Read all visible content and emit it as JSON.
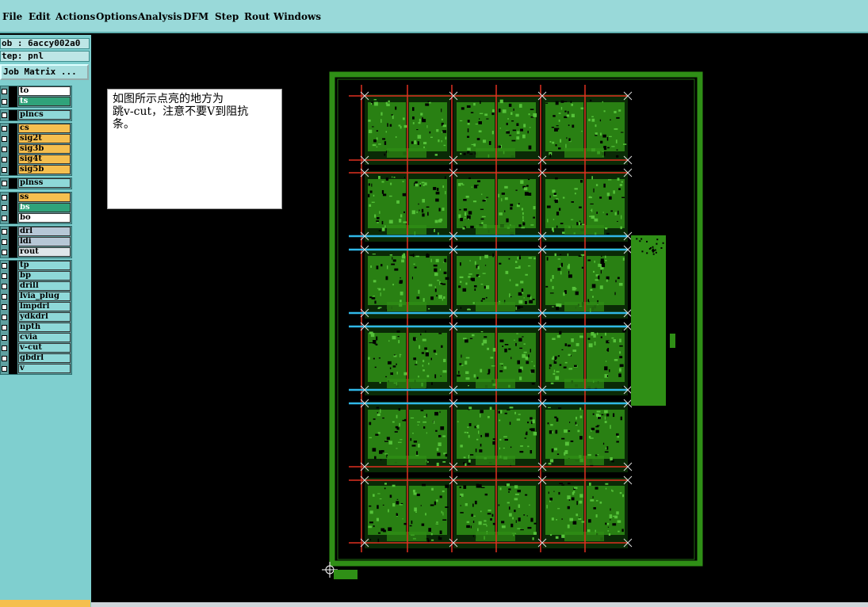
{
  "menu": {
    "items": [
      "File",
      "Edit",
      "Actions",
      "Options",
      "Analysis",
      "DFM",
      "Step",
      "Rout",
      "Windows"
    ]
  },
  "job_info": {
    "job": "ob : 6accy002a0",
    "step": "tep: pnl",
    "job_matrix_button": "Job Matrix ..."
  },
  "layers": [
    {
      "name": "to",
      "color": "w"
    },
    {
      "name": "ts",
      "color": "g"
    },
    {
      "name": "plncs",
      "color": "c"
    },
    {
      "name": "cs",
      "color": "o"
    },
    {
      "name": "sig2t",
      "color": "o"
    },
    {
      "name": "sig3b",
      "color": "o"
    },
    {
      "name": "sig4t",
      "color": "o"
    },
    {
      "name": "sig5b",
      "color": "o"
    },
    {
      "name": "plnss",
      "color": "c"
    },
    {
      "name": "ss",
      "color": "o"
    },
    {
      "name": "bs",
      "color": "g"
    },
    {
      "name": "bo",
      "color": "w"
    },
    {
      "name": "drl",
      "color": "b"
    },
    {
      "name": "ldi",
      "color": "b"
    },
    {
      "name": "rout",
      "color": "l"
    },
    {
      "name": "tp",
      "color": "c"
    },
    {
      "name": "bp",
      "color": "c"
    },
    {
      "name": "drill",
      "color": "c"
    },
    {
      "name": "lvia_plug",
      "color": "c"
    },
    {
      "name": "lmpdrl",
      "color": "c"
    },
    {
      "name": "ydkdrl",
      "color": "c"
    },
    {
      "name": "npth",
      "color": "c"
    },
    {
      "name": "cvia",
      "color": "c"
    },
    {
      "name": "v-cut",
      "color": "c"
    },
    {
      "name": "gbdrl",
      "color": "c"
    },
    {
      "name": "v",
      "color": "c"
    }
  ],
  "note": {
    "text": "如图所示点亮的地方为\n跳v-cut，注意不要V到阻抗\n条。"
  },
  "colors": {
    "menubar": "#99d9d9",
    "panel": "#7fcfcf",
    "pcb_green": "#2f8f16",
    "vcut_red": "#e03020",
    "highlight_cyan": "#30b8e8",
    "canvas": "#000000"
  }
}
